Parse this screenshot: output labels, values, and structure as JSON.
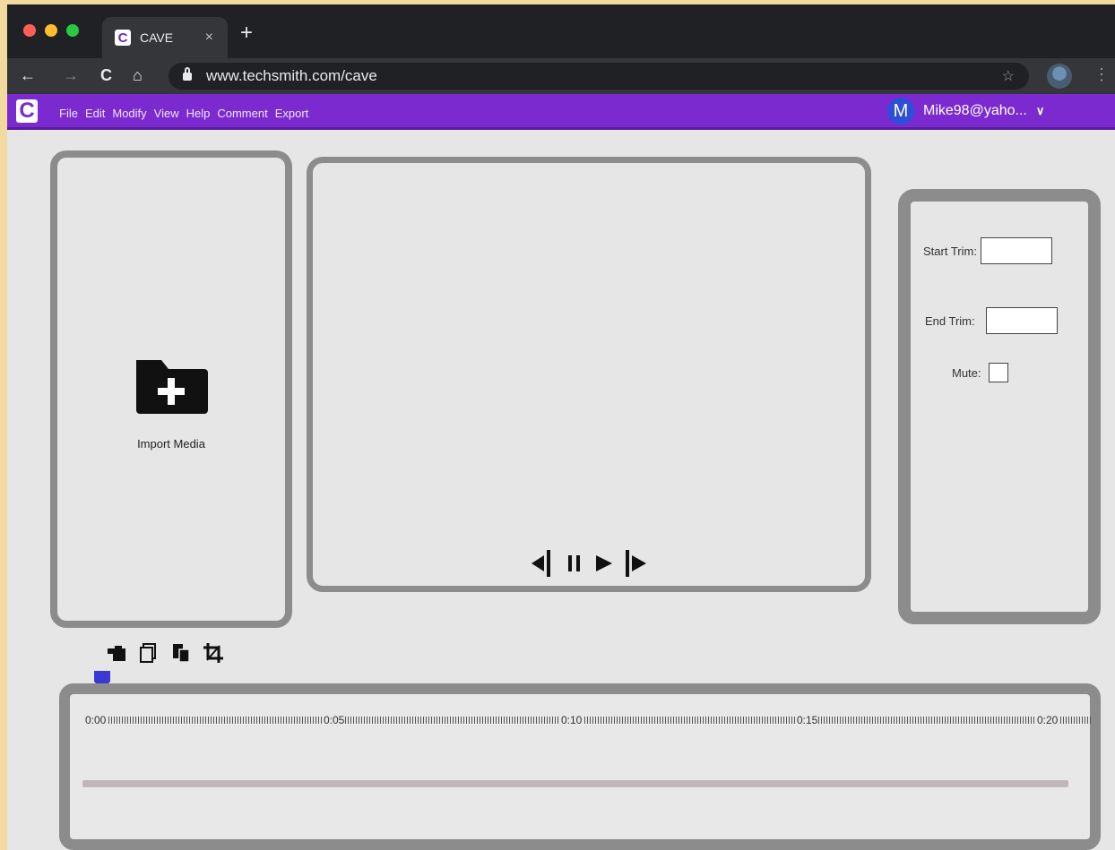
{
  "browser": {
    "tab_title": "CAVE",
    "tab_close": "×",
    "new_tab": "+",
    "url": "www.techsmith.com/cave",
    "nav": {
      "back": "←",
      "forward": "→",
      "reload": "C",
      "home": "⌂",
      "star": "☆",
      "menu": "⋮"
    }
  },
  "app": {
    "logo": "C",
    "favicon": "C",
    "menu": [
      "File",
      "Edit",
      "Modify",
      "View",
      "Help",
      "Comment",
      "Export"
    ],
    "user": {
      "initial": "M",
      "name": "Mike98@yaho...",
      "caret": "∨"
    },
    "accent": "#7b2ad0"
  },
  "media_panel": {
    "import_label": "Import Media"
  },
  "properties": {
    "start_trim_label": "Start Trim:",
    "end_trim_label": "End Trim:",
    "mute_label": "Mute:",
    "start_trim_value": "",
    "end_trim_value": ""
  },
  "tools": [
    "hand-stamp-icon",
    "copy-icon",
    "paste-icon",
    "crop-icon"
  ],
  "timeline": {
    "labels": [
      "0:00",
      "0:05",
      "0:10",
      "0:15",
      "0:20"
    ],
    "playhead_color": "#3a3ad0"
  }
}
